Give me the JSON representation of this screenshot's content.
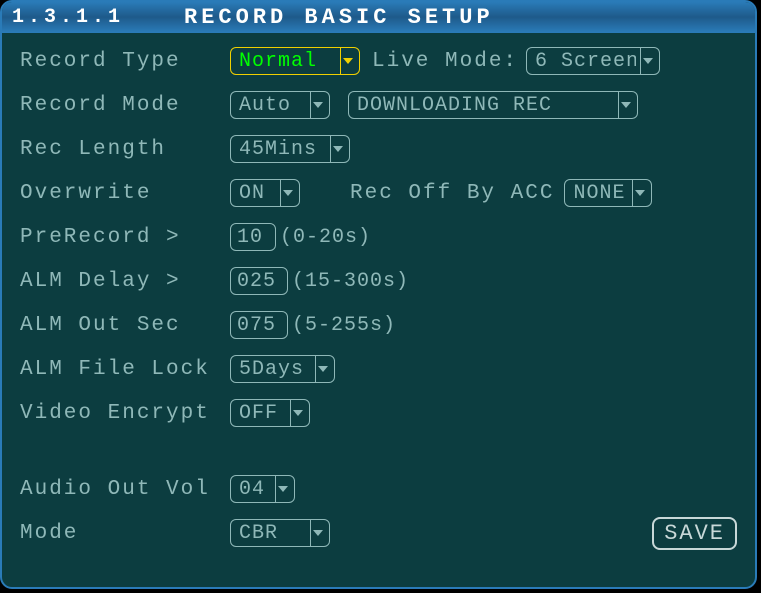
{
  "header": {
    "version": "1.3.1.1",
    "title": "RECORD BASIC SETUP"
  },
  "recordType": {
    "label": "Record Type",
    "value": "Normal"
  },
  "liveMode": {
    "label": "Live Mode:",
    "value": "6 Screen"
  },
  "recordMode": {
    "label": "Record Mode",
    "value": "Auto"
  },
  "downloading": {
    "value": "DOWNLOADING REC"
  },
  "recLength": {
    "label": "Rec Length",
    "value": "45Mins"
  },
  "overwrite": {
    "label": "Overwrite",
    "value": "ON"
  },
  "recOffByAcc": {
    "label": "Rec Off By ACC",
    "value": "NONE"
  },
  "preRecord": {
    "label": "PreRecord >",
    "value": "10",
    "hint": "(0-20s)"
  },
  "almDelay": {
    "label": "ALM Delay >",
    "value": "025",
    "hint": "(15-300s)"
  },
  "almOutSec": {
    "label": "ALM Out Sec",
    "value": "075",
    "hint": "(5-255s)"
  },
  "almFileLock": {
    "label": "ALM File Lock",
    "value": "5Days"
  },
  "videoEncrypt": {
    "label": "Video Encrypt",
    "value": "OFF"
  },
  "audioOutVol": {
    "label": "Audio Out Vol",
    "value": "04"
  },
  "mode": {
    "label": "Mode",
    "value": "CBR"
  },
  "saveButton": {
    "label": "SAVE"
  }
}
